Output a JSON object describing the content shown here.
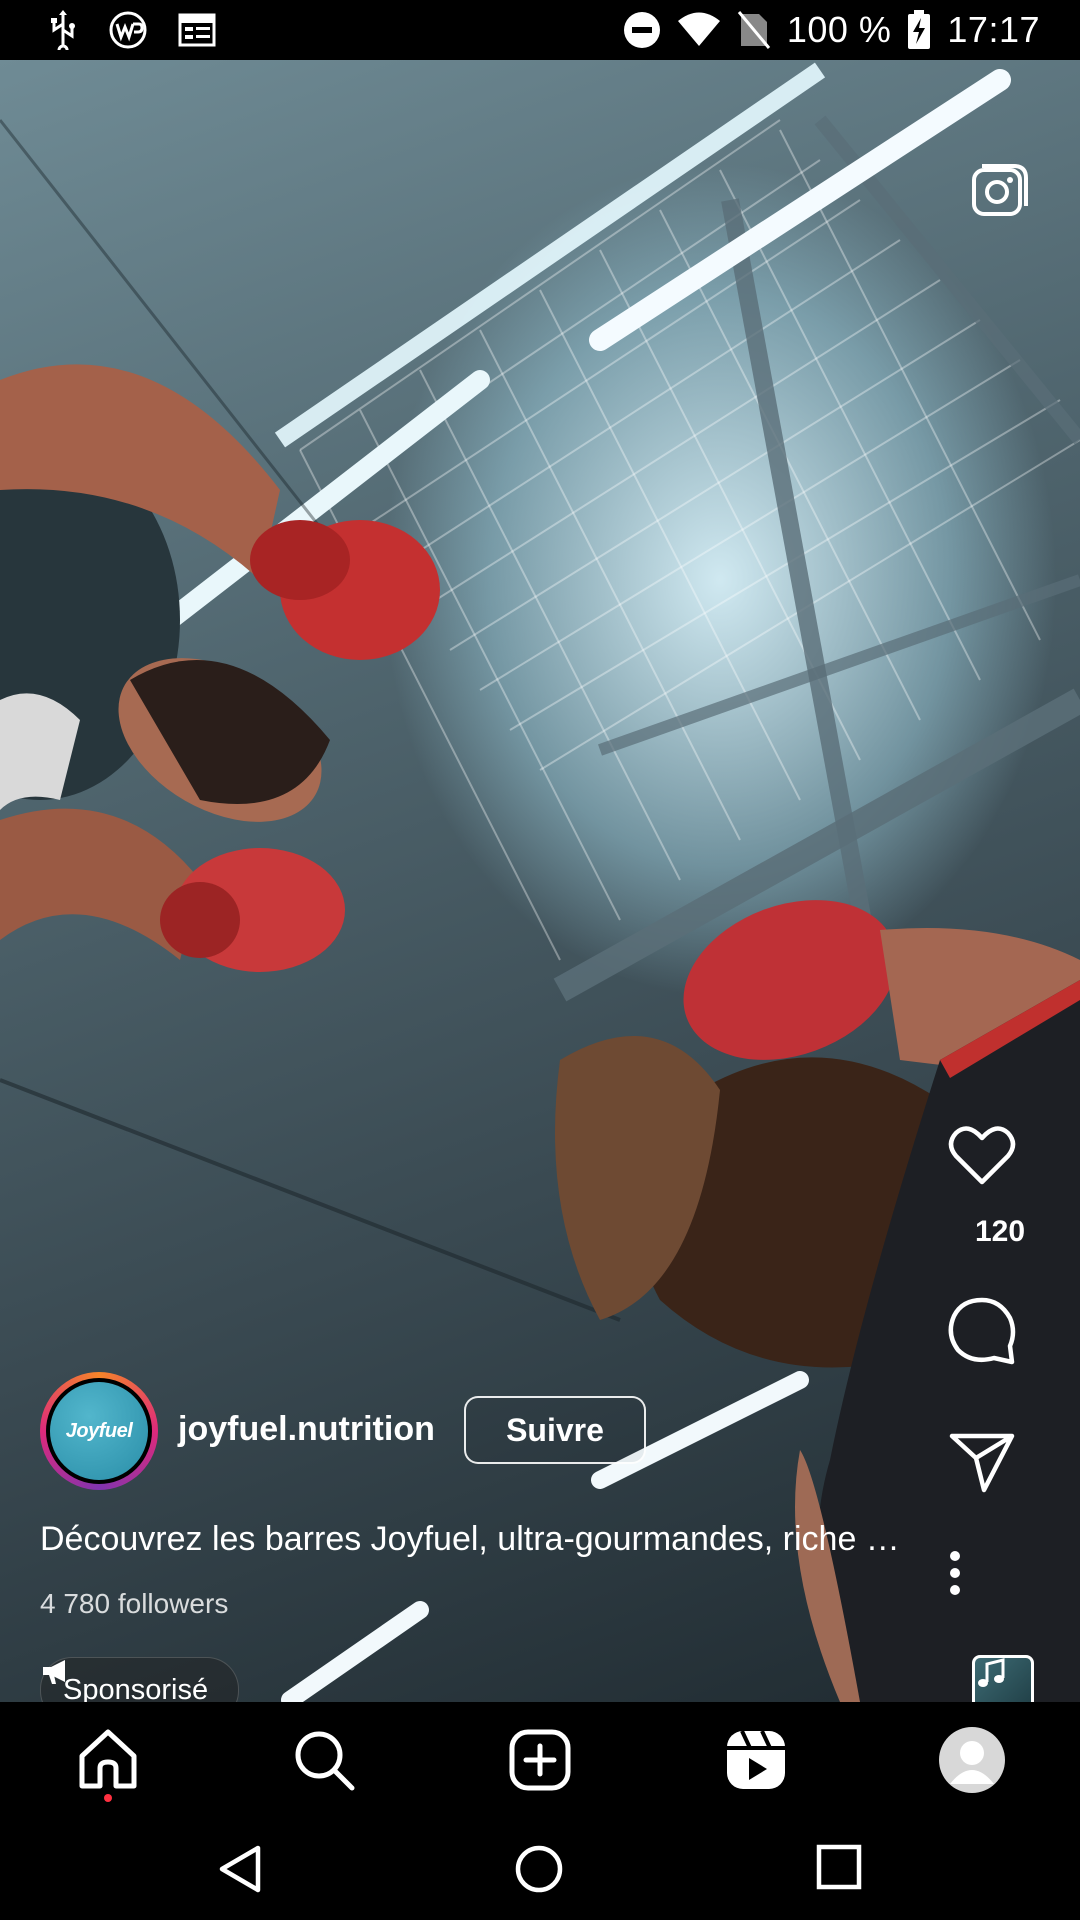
{
  "status_bar": {
    "battery": "100 %",
    "time": "17:17",
    "icons_left": [
      "usb-icon",
      "wps-icon",
      "calendar-icon"
    ],
    "icons_right": [
      "dnd-icon",
      "wifi-icon",
      "no-sim-icon",
      "battery-charging-icon"
    ]
  },
  "post": {
    "username": "joyfuel.nutrition",
    "avatar_text": "Joyfuel",
    "follow_label": "Suivre",
    "caption": "Découvrez les barres Joyfuel, ultra-gourmandes, riche …",
    "followers": "4 780 followers",
    "sponsored_label": "Sponsorisé"
  },
  "actions": {
    "like_count": "120",
    "icons": [
      "camera-icon",
      "heart-icon",
      "comment-icon",
      "share-icon",
      "more-icon",
      "audio-icon"
    ]
  },
  "bottom_nav": [
    "home-icon",
    "search-icon",
    "create-icon",
    "reels-icon",
    "profile-icon"
  ],
  "system_nav": [
    "back-icon",
    "home-circle-icon",
    "recents-icon"
  ],
  "colors": {
    "background": "#000000",
    "text": "#ffffff",
    "notification_dot": "#ff3040",
    "avatar_bg": "#2a8ea8"
  }
}
